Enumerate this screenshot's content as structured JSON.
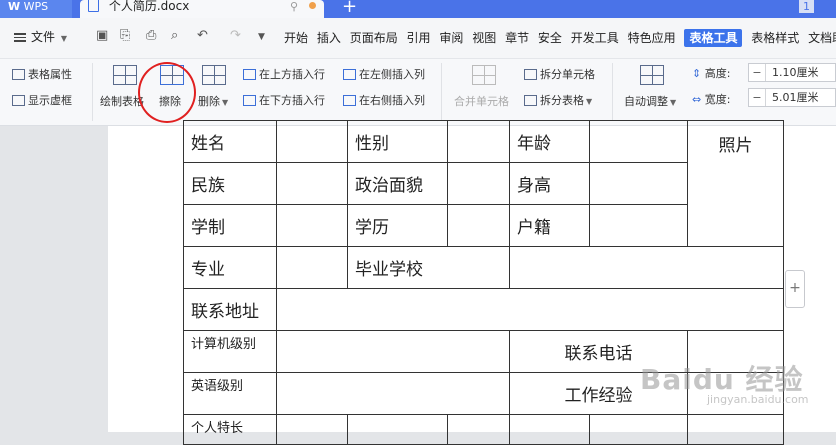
{
  "titlebar": {
    "app_tab": "WPS",
    "doc_tab": "个人简历.docx",
    "new_tab": "+",
    "window_count": "1"
  },
  "menubar": {
    "file_label": "文件",
    "tabs": [
      "开始",
      "插入",
      "页面布局",
      "引用",
      "审阅",
      "视图",
      "章节",
      "安全",
      "开发工具",
      "特色应用",
      "表格工具",
      "表格样式",
      "文档助手"
    ],
    "active_tab": "表格工具"
  },
  "ribbon": {
    "table_props": "表格属性",
    "show_gridlines": "显示虚框",
    "draw_table": "绘制表格",
    "erase": "擦除",
    "delete": "删除",
    "insert_above": "在上方插入行",
    "insert_below": "在下方插入行",
    "insert_left": "在左侧插入列",
    "insert_right": "在右侧插入列",
    "merge_cells": "合并单元格",
    "split_cells": "拆分单元格",
    "split_table": "拆分表格",
    "auto_fit": "自动调整",
    "height_label": "高度:",
    "height_value": "1.10厘米",
    "width_label": "宽度:",
    "width_value": "5.01厘米"
  },
  "table": {
    "name": "姓名",
    "gender": "性别",
    "age": "年龄",
    "photo": "照片",
    "ethnicity": "民族",
    "politics": "政治面貌",
    "height": "身高",
    "schooling": "学制",
    "education": "学历",
    "hukou": "户籍",
    "major": "专业",
    "school": "毕业学校",
    "address": "联系地址",
    "computer_level": "计算机级别",
    "phone": "联系电话",
    "english_level": "英语级别",
    "experience": "工作经验",
    "specialty": "个人特长"
  },
  "sidebar_button": "+",
  "watermark": {
    "text": "Baidu 经验",
    "url": "jingyan.baidu.com"
  },
  "colors": {
    "title_blue": "#4a73e8",
    "active_tab_blue": "#3c73eb",
    "annotation_red": "#e02020"
  }
}
